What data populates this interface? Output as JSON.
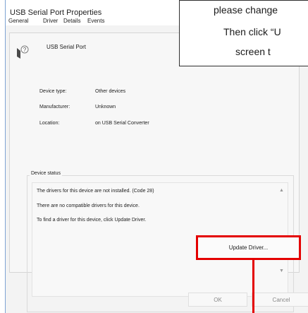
{
  "window": {
    "title": "USB Serial Port Properties",
    "tabs": [
      "General",
      "Driver",
      "Details",
      "Events"
    ],
    "device_name": "USB Serial Port",
    "properties": [
      {
        "label": "Device type:",
        "value": "Other devices"
      },
      {
        "label": "Manufacturer:",
        "value": "Unknown"
      },
      {
        "label": "Location:",
        "value": "on USB Serial Converter"
      }
    ],
    "status_label": "Device status",
    "status_lines": [
      "The drivers for this device are not installed. (Code 28)",
      "There are no compatible drivers for this device.",
      "To find a driver for this device, click Update Driver."
    ],
    "update_button": "Update Driver...",
    "ok_button": "OK",
    "cancel_button": "Cancel"
  },
  "callout": {
    "line1": "please change",
    "line2": "Then click “U",
    "line3": "screen t"
  },
  "colors": {
    "highlight": "#e40000",
    "border": "#7ea3d3"
  },
  "icons": {
    "device": "usb-serial-port-icon",
    "scroll_up": "scroll-up-icon",
    "scroll_down": "scroll-down-icon"
  }
}
